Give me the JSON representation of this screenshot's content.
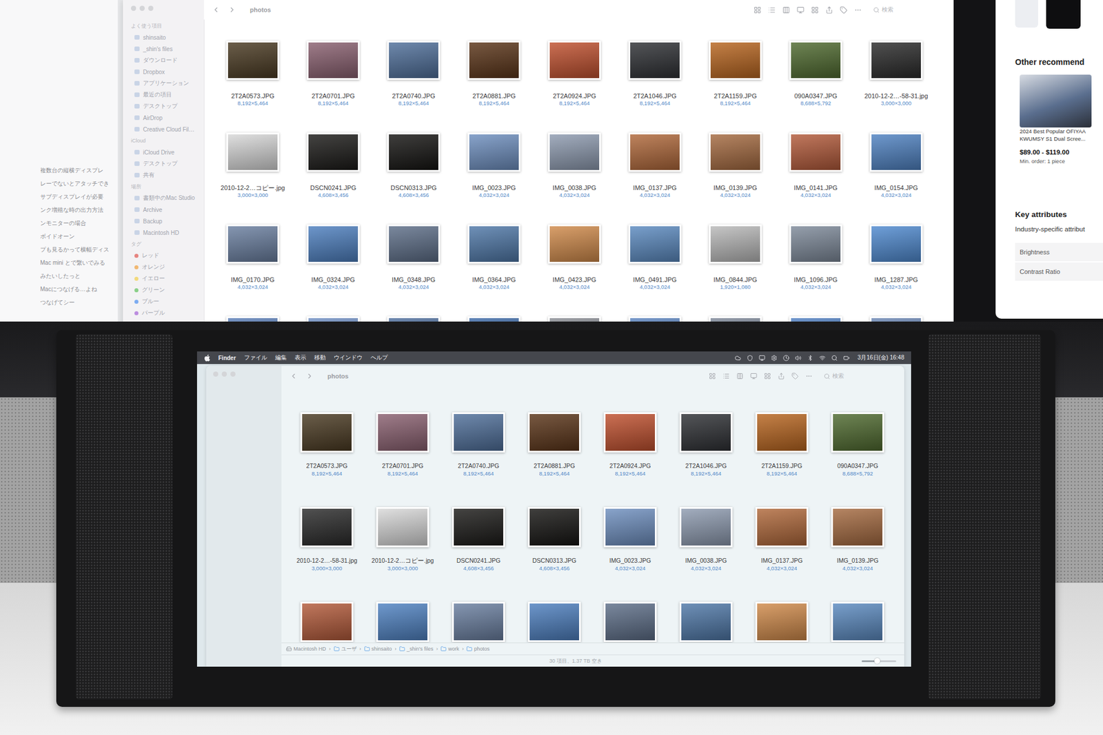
{
  "left_window": {
    "lines": [
      "複数台の縦横ディスプレ",
      "レーでないとアタッチでき",
      "サブディスプレイが必要",
      "ンク増殖な時の出力方法",
      "ンモニターの場合",
      "ボイドオーン",
      "プも見るかって横幅ディス",
      "Mac mini とで繋いでみる",
      "みたいしたっと",
      "Macにつなげる…よね",
      "つなげてシー"
    ]
  },
  "top_finder": {
    "title": "photos",
    "search": {
      "placeholder": "検索"
    },
    "sidebar": {
      "items": [
        {
          "label": "よく使う項目",
          "kind": "heading"
        },
        {
          "label": "shinsaito",
          "kind": "item"
        },
        {
          "label": "_shin's files",
          "kind": "item"
        },
        {
          "label": "ダウンロード",
          "kind": "item"
        },
        {
          "label": "Dropbox",
          "kind": "item"
        },
        {
          "label": "アプリケーション",
          "kind": "item"
        },
        {
          "label": "最近の項目",
          "kind": "item"
        },
        {
          "label": "デスクトップ",
          "kind": "item"
        },
        {
          "label": "AirDrop",
          "kind": "item"
        },
        {
          "label": "Creative Cloud Fil…",
          "kind": "item"
        },
        {
          "label": "iCloud",
          "kind": "heading"
        },
        {
          "label": "iCloud Drive",
          "kind": "item"
        },
        {
          "label": "デスクトップ",
          "kind": "item"
        },
        {
          "label": "共有",
          "kind": "item"
        },
        {
          "label": "場所",
          "kind": "heading"
        },
        {
          "label": "書類中のMac Studio",
          "kind": "item"
        },
        {
          "label": "Archive",
          "kind": "item"
        },
        {
          "label": "Backup",
          "kind": "item"
        },
        {
          "label": "Macintosh HD",
          "kind": "item"
        },
        {
          "label": "タグ",
          "kind": "heading"
        },
        {
          "label": "レッド",
          "kind": "tag",
          "color": "#e0554f"
        },
        {
          "label": "オレンジ",
          "kind": "tag",
          "color": "#f0a03a"
        },
        {
          "label": "イエロー",
          "kind": "tag",
          "color": "#f2d04a"
        },
        {
          "label": "グリーン",
          "kind": "tag",
          "color": "#5cc05a"
        },
        {
          "label": "ブルー",
          "kind": "tag",
          "color": "#4a8ff0"
        },
        {
          "label": "パープル",
          "kind": "tag",
          "color": "#a463d6"
        }
      ]
    },
    "files": [
      {
        "name": "2T2A0573.JPG",
        "dims": "8,192×5,464",
        "color": "#4a3a22"
      },
      {
        "name": "2T2A0701.JPG",
        "dims": "8,192×5,464",
        "color": "#8a6070"
      },
      {
        "name": "2T2A0740.JPG",
        "dims": "8,192×5,464",
        "color": "#4f6f9a"
      },
      {
        "name": "2T2A0881.JPG",
        "dims": "8,192×5,464",
        "color": "#5a3418"
      },
      {
        "name": "2T2A0924.JPG",
        "dims": "8,192×5,464",
        "color": "#c0502e"
      },
      {
        "name": "2T2A1046.JPG",
        "dims": "8,192×5,464",
        "color": "#2e3034"
      },
      {
        "name": "2T2A1159.JPG",
        "dims": "8,192×5,464",
        "color": "#b8651f"
      },
      {
        "name": "090A0347.JPG",
        "dims": "8,688×5,792",
        "color": "#4f6a2f"
      },
      {
        "name": "2010-12-2…-58-31.jpg",
        "dims": "3,000×3,000",
        "color": "#2a2a2a"
      },
      {
        "name": "2010-12-2…コピー.jpg",
        "dims": "3,000×3,000",
        "color": "#d8d8d8"
      },
      {
        "name": "DSCN0241.JPG",
        "dims": "4,608×3,456",
        "color": "#1b1a18"
      },
      {
        "name": "DSCN0313.JPG",
        "dims": "4,608×3,456",
        "color": "#151412"
      },
      {
        "name": "IMG_0023.JPG",
        "dims": "4,032×3,024",
        "color": "#6e8fbf"
      },
      {
        "name": "IMG_0038.JPG",
        "dims": "4,032×3,024",
        "color": "#8e9bb0"
      },
      {
        "name": "IMG_0137.JPG",
        "dims": "4,032×3,024",
        "color": "#b0683a"
      },
      {
        "name": "IMG_0139.JPG",
        "dims": "4,032×3,024",
        "color": "#a56a40"
      },
      {
        "name": "IMG_0141.JPG",
        "dims": "4,032×3,024",
        "color": "#b35a3a"
      },
      {
        "name": "IMG_0154.JPG",
        "dims": "4,032×3,024",
        "color": "#4f82c2"
      },
      {
        "name": "IMG_0170.JPG",
        "dims": "4,032×3,024",
        "color": "#6a7fa0"
      },
      {
        "name": "IMG_0324.JPG",
        "dims": "4,032×3,024",
        "color": "#4d7fbf"
      },
      {
        "name": "IMG_0348.JPG",
        "dims": "4,032×3,024",
        "color": "#5d6e88"
      },
      {
        "name": "IMG_0364.JPG",
        "dims": "4,032×3,024",
        "color": "#4f78a8"
      },
      {
        "name": "IMG_0423.JPG",
        "dims": "4,032×3,024",
        "color": "#d08a4a"
      },
      {
        "name": "IMG_0491.JPG",
        "dims": "4,032×3,024",
        "color": "#5b8ac0"
      },
      {
        "name": "IMG_0844.JPG",
        "dims": "1,920×1,080",
        "color": "#b9b9b9"
      },
      {
        "name": "IMG_1096.JPG",
        "dims": "4,032×3,024",
        "color": "#7e8a9a"
      },
      {
        "name": "IMG_1287.JPG",
        "dims": "4,032×3,024",
        "color": "#4f8ad0"
      }
    ],
    "partial_row": [
      {
        "color": "#5a7eb8"
      },
      {
        "color": "#6f8fc4"
      },
      {
        "color": "#4f6f9e"
      },
      {
        "color": "#3d6aa8"
      },
      {
        "color": "#8a8d94"
      },
      {
        "color": "#5b84c0"
      },
      {
        "color": "#7d8798"
      },
      {
        "color": "#4f7fc2"
      },
      {
        "color": "#6a86b4"
      }
    ]
  },
  "web_page": {
    "heading": "Other recommend",
    "product": {
      "caption": [
        "2024 Best Popular OFIYAA",
        "KWUMSY S1 Dual Scree..."
      ],
      "price": "$89.00 - $119.00",
      "min_order": "Min. order: 1 piece"
    },
    "section": "Key attributes",
    "subsection": "Industry-specific attribut",
    "attributes": [
      "Brightness",
      "Contrast Ratio"
    ]
  },
  "portable_monitor": {
    "menu_bar": {
      "items": [
        {
          "label": "Finder",
          "bold": true
        },
        {
          "label": "ファイル",
          "bold": false
        },
        {
          "label": "編集",
          "bold": false
        },
        {
          "label": "表示",
          "bold": false
        },
        {
          "label": "移動",
          "bold": false
        },
        {
          "label": "ウインドウ",
          "bold": false
        },
        {
          "label": "ヘルプ",
          "bold": false
        }
      ],
      "clock": "3月16日(金) 16:48"
    },
    "finder": {
      "title": "photos",
      "search": {
        "placeholder": "検索"
      },
      "files": [
        {
          "name": "2T2A0573.JPG",
          "dims": "8,192×5,464",
          "color": "#4a3a22"
        },
        {
          "name": "2T2A0701.JPG",
          "dims": "8,192×5,464",
          "color": "#8a6070"
        },
        {
          "name": "2T2A0740.JPG",
          "dims": "8,192×5,464",
          "color": "#4f6f9a"
        },
        {
          "name": "2T2A0881.JPG",
          "dims": "8,192×5,464",
          "color": "#5a3418"
        },
        {
          "name": "2T2A0924.JPG",
          "dims": "8,192×5,464",
          "color": "#c0502e"
        },
        {
          "name": "2T2A1046.JPG",
          "dims": "8,192×5,464",
          "color": "#2e3034"
        },
        {
          "name": "2T2A1159.JPG",
          "dims": "8,192×5,464",
          "color": "#b8651f"
        },
        {
          "name": "090A0347.JPG",
          "dims": "8,688×5,792",
          "color": "#4f6a2f"
        },
        {
          "name": "2010-12-2…-58-31.jpg",
          "dims": "3,000×3,000",
          "color": "#2a2a2a"
        },
        {
          "name": "2010-12-2…コピー.jpg",
          "dims": "3,000×3,000",
          "color": "#d8d8d8"
        },
        {
          "name": "DSCN0241.JPG",
          "dims": "4,608×3,456",
          "color": "#1b1a18"
        },
        {
          "name": "DSCN0313.JPG",
          "dims": "4,608×3,456",
          "color": "#151412"
        },
        {
          "name": "IMG_0023.JPG",
          "dims": "4,032×3,024",
          "color": "#6e8fbf"
        },
        {
          "name": "IMG_0038.JPG",
          "dims": "4,032×3,024",
          "color": "#8e9bb0"
        },
        {
          "name": "IMG_0137.JPG",
          "dims": "4,032×3,024",
          "color": "#b0683a"
        },
        {
          "name": "IMG_0139.JPG",
          "dims": "4,032×3,024",
          "color": "#a56a40"
        }
      ],
      "partial_row": [
        {
          "color": "#b35a3a"
        },
        {
          "color": "#4f82c2"
        },
        {
          "color": "#6a7fa0"
        },
        {
          "color": "#4d7fbf"
        },
        {
          "color": "#5d6e88"
        },
        {
          "color": "#4f78a8"
        },
        {
          "color": "#d08a4a"
        },
        {
          "color": "#5b8ac0"
        }
      ],
      "path_bar": {
        "separator": "›",
        "items": [
          "Macintosh HD",
          "ユーザ",
          "shinsaito",
          "_shin's files",
          "work",
          "photos"
        ]
      },
      "status": "30 項目、1.37 TB 空き",
      "zoom_slider": {
        "level": 0.45
      }
    }
  }
}
